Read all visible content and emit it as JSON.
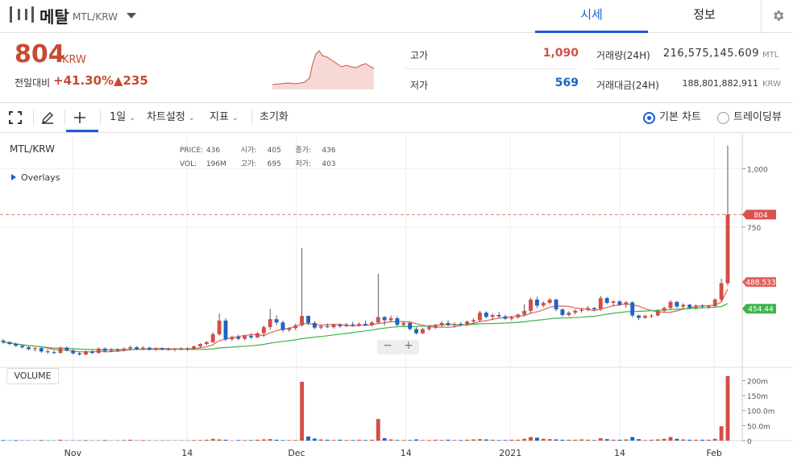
{
  "header": {
    "coin_name": "메탈",
    "pair": "MTL/KRW",
    "tabs": [
      {
        "label": "시세",
        "active": true
      },
      {
        "label": "정보",
        "active": false
      }
    ]
  },
  "summary": {
    "price": "804",
    "unit": "KRW",
    "change_label": "전일대비",
    "change_rate": "+41.30%",
    "change_amount": "▲235",
    "high_label": "고가",
    "high_value": "1,090",
    "low_label": "저가",
    "low_value": "569",
    "volume_label": "거래량(24H)",
    "volume_value": "216,575,145.609",
    "volume_unit": "MTL",
    "amount_label": "거래대금(24H)",
    "amount_value": "188,801,882,911",
    "amount_unit": "KRW"
  },
  "toolbar": {
    "period": "1일",
    "chart_settings": "차트설정",
    "indicators": "지표",
    "reset": "초기화",
    "basic_chart": "기본 차트",
    "trading_view": "트레이딩뷰"
  },
  "chart_info": {
    "symbol": "MTL/KRW",
    "overlays": "Overlays",
    "price_label": "PRICE:",
    "price_val": "436",
    "open_label": "시가:",
    "open_val": "405",
    "close_label": "종가:",
    "close_val": "436",
    "vol_label": "VOL:",
    "vol_val": "196M",
    "high_label": "고가:",
    "high_val": "695",
    "low_label": "저가:",
    "low_val": "403",
    "volume_panel": "VOLUME"
  },
  "colors": {
    "up": "#d24f45",
    "down": "#1c64c8",
    "ma_short": "#e0625c",
    "ma_long": "#3eb44a",
    "accent": "#1a5dd6"
  },
  "chart_data": {
    "type": "candlestick",
    "x_ticks": [
      "Nov",
      "14",
      "Dec",
      "14",
      "2021",
      "14",
      "Feb"
    ],
    "price_axis_ticks": [
      "1,000",
      "750"
    ],
    "volume_axis_ticks": [
      "200m",
      "150m",
      "100.0m",
      "50.0m",
      "0"
    ],
    "price_tags": {
      "current": "804",
      "ma_short": "488.533",
      "ma_long": "454.44"
    },
    "candles": [
      [
        265,
        270,
        250,
        258
      ],
      [
        258,
        262,
        245,
        250
      ],
      [
        250,
        256,
        238,
        242
      ],
      [
        242,
        248,
        230,
        236
      ],
      [
        236,
        240,
        222,
        228
      ],
      [
        228,
        236,
        218,
        232
      ],
      [
        232,
        238,
        212,
        218
      ],
      [
        218,
        226,
        208,
        215
      ],
      [
        215,
        222,
        206,
        212
      ],
      [
        212,
        240,
        208,
        234
      ],
      [
        234,
        240,
        218,
        222
      ],
      [
        222,
        228,
        205,
        210
      ],
      [
        210,
        216,
        200,
        205
      ],
      [
        205,
        222,
        202,
        218
      ],
      [
        218,
        224,
        206,
        212
      ],
      [
        212,
        236,
        208,
        230
      ],
      [
        230,
        236,
        214,
        220
      ],
      [
        220,
        232,
        215,
        226
      ],
      [
        226,
        232,
        216,
        222
      ],
      [
        222,
        236,
        218,
        230
      ],
      [
        230,
        244,
        222,
        236
      ],
      [
        236,
        240,
        224,
        228
      ],
      [
        228,
        240,
        224,
        234
      ],
      [
        234,
        238,
        222,
        226
      ],
      [
        226,
        236,
        220,
        232
      ],
      [
        232,
        236,
        222,
        228
      ],
      [
        228,
        234,
        222,
        226
      ],
      [
        226,
        232,
        218,
        230
      ],
      [
        230,
        236,
        224,
        226
      ],
      [
        226,
        236,
        220,
        232
      ],
      [
        232,
        244,
        226,
        240
      ],
      [
        240,
        254,
        234,
        250
      ],
      [
        250,
        262,
        244,
        258
      ],
      [
        258,
        300,
        254,
        292
      ],
      [
        292,
        380,
        286,
        350
      ],
      [
        350,
        360,
        262,
        270
      ],
      [
        270,
        286,
        262,
        280
      ],
      [
        280,
        290,
        266,
        272
      ],
      [
        272,
        288,
        266,
        284
      ],
      [
        284,
        296,
        272,
        278
      ],
      [
        278,
        300,
        276,
        296
      ],
      [
        296,
        330,
        280,
        322
      ],
      [
        322,
        400,
        312,
        356
      ],
      [
        356,
        372,
        330,
        342
      ],
      [
        342,
        350,
        300,
        310
      ],
      [
        310,
        322,
        302,
        318
      ],
      [
        318,
        336,
        310,
        330
      ],
      [
        330,
        660,
        324,
        370
      ],
      [
        370,
        372,
        330,
        340
      ],
      [
        340,
        348,
        314,
        320
      ],
      [
        320,
        334,
        312,
        326
      ],
      [
        326,
        338,
        318,
        322
      ],
      [
        322,
        336,
        316,
        332
      ],
      [
        332,
        338,
        318,
        326
      ],
      [
        326,
        340,
        322,
        334
      ],
      [
        334,
        344,
        324,
        330
      ],
      [
        330,
        342,
        324,
        336
      ],
      [
        336,
        350,
        328,
        330
      ],
      [
        330,
        348,
        324,
        342
      ],
      [
        342,
        550,
        336,
        365
      ],
      [
        365,
        370,
        330,
        352
      ],
      [
        352,
        372,
        344,
        360
      ],
      [
        360,
        368,
        326,
        332
      ],
      [
        332,
        346,
        324,
        340
      ],
      [
        340,
        346,
        308,
        314
      ],
      [
        314,
        322,
        290,
        296
      ],
      [
        296,
        318,
        292,
        314
      ],
      [
        314,
        328,
        306,
        322
      ],
      [
        322,
        336,
        314,
        330
      ],
      [
        330,
        348,
        324,
        340
      ],
      [
        340,
        352,
        326,
        332
      ],
      [
        332,
        342,
        320,
        336
      ],
      [
        336,
        344,
        328,
        332
      ],
      [
        332,
        350,
        326,
        346
      ],
      [
        346,
        360,
        336,
        352
      ],
      [
        352,
        392,
        344,
        384
      ],
      [
        384,
        390,
        360,
        366
      ],
      [
        366,
        380,
        352,
        374
      ],
      [
        374,
        388,
        362,
        368
      ],
      [
        368,
        376,
        352,
        358
      ],
      [
        358,
        370,
        350,
        364
      ],
      [
        364,
        380,
        358,
        376
      ],
      [
        376,
        420,
        368,
        392
      ],
      [
        392,
        448,
        380,
        440
      ],
      [
        440,
        452,
        404,
        414
      ],
      [
        414,
        432,
        408,
        426
      ],
      [
        426,
        446,
        420,
        440
      ],
      [
        440,
        444,
        390,
        398
      ],
      [
        398,
        402,
        368,
        374
      ],
      [
        374,
        390,
        368,
        384
      ],
      [
        384,
        398,
        376,
        392
      ],
      [
        392,
        404,
        384,
        396
      ],
      [
        396,
        412,
        390,
        404
      ],
      [
        404,
        408,
        392,
        398
      ],
      [
        398,
        456,
        392,
        446
      ],
      [
        446,
        452,
        420,
        426
      ],
      [
        426,
        436,
        412,
        432
      ],
      [
        432,
        438,
        414,
        418
      ],
      [
        418,
        434,
        406,
        428
      ],
      [
        428,
        432,
        364,
        372
      ],
      [
        372,
        376,
        352,
        362
      ],
      [
        362,
        376,
        358,
        370
      ],
      [
        370,
        378,
        360,
        372
      ],
      [
        372,
        398,
        368,
        392
      ],
      [
        392,
        410,
        386,
        404
      ],
      [
        404,
        438,
        396,
        430
      ],
      [
        430,
        434,
        404,
        410
      ],
      [
        410,
        424,
        398,
        418
      ],
      [
        418,
        422,
        400,
        406
      ],
      [
        406,
        420,
        398,
        414
      ],
      [
        414,
        420,
        404,
        410
      ],
      [
        410,
        416,
        400,
        412
      ],
      [
        412,
        446,
        408,
        440
      ],
      [
        440,
        530,
        432,
        510
      ],
      [
        510,
        1100,
        500,
        804
      ]
    ],
    "volume": [
      2,
      1,
      2,
      1,
      1,
      1,
      2,
      1,
      1,
      3,
      1,
      1,
      1,
      2,
      1,
      1,
      2,
      1,
      1,
      2,
      3,
      1,
      2,
      1,
      1,
      1,
      1,
      1,
      1,
      1,
      2,
      2,
      3,
      6,
      4,
      3,
      1,
      2,
      2,
      2,
      3,
      4,
      5,
      3,
      2,
      2,
      2,
      196,
      14,
      7,
      4,
      3,
      2,
      3,
      2,
      2,
      3,
      2,
      3,
      72,
      8,
      4,
      2,
      2,
      2,
      4,
      2,
      2,
      3,
      2,
      3,
      2,
      2,
      3,
      4,
      5,
      4,
      3,
      2,
      2,
      3,
      3,
      6,
      12,
      10,
      6,
      5,
      4,
      3,
      3,
      3,
      4,
      3,
      2,
      8,
      5,
      3,
      3,
      4,
      12,
      5,
      2,
      3,
      4,
      6,
      12,
      6,
      4,
      3,
      3,
      3,
      3,
      6,
      48,
      215
    ]
  }
}
